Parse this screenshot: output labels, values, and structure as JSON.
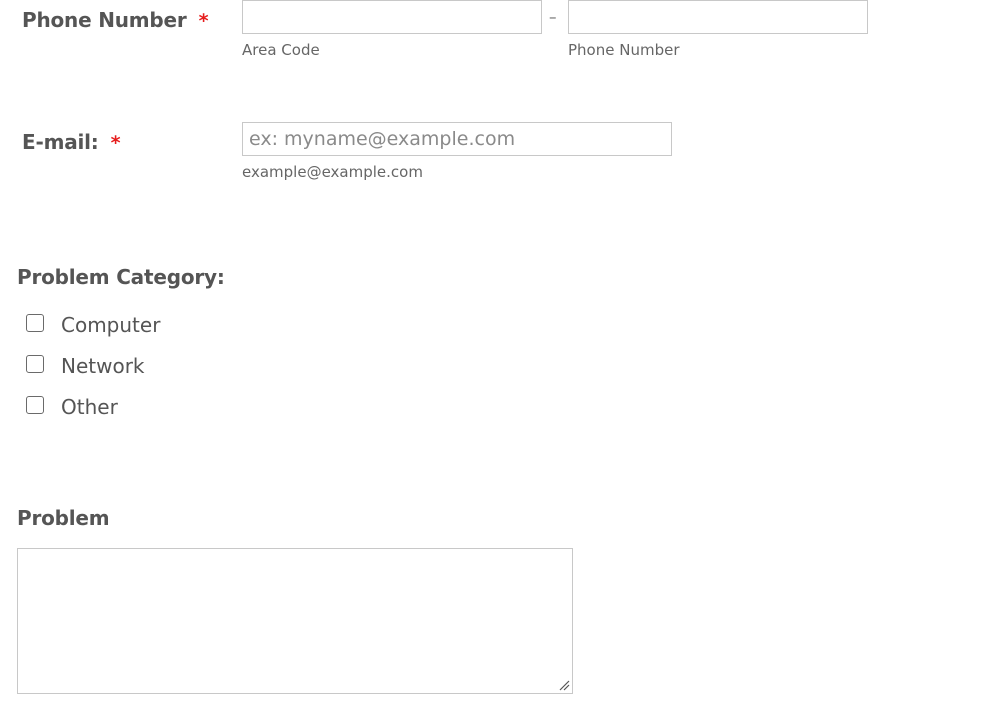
{
  "phone": {
    "label": "Phone Number",
    "required_mark": "*",
    "area_code": {
      "value": "",
      "sublabel": "Area Code"
    },
    "separator": "–",
    "number": {
      "value": "",
      "sublabel": "Phone Number"
    }
  },
  "email": {
    "label": "E-mail:",
    "required_mark": "*",
    "placeholder": "ex: myname@example.com",
    "value": "",
    "sublabel": "example@example.com"
  },
  "problem_category": {
    "label": "Problem Category:",
    "options": [
      {
        "label": "Computer",
        "checked": false
      },
      {
        "label": "Network",
        "checked": false
      },
      {
        "label": "Other",
        "checked": false
      }
    ]
  },
  "problem": {
    "label": "Problem",
    "value": ""
  },
  "colors": {
    "required": "#e61c1c",
    "text": "#555555",
    "border": "#c8c8c8"
  }
}
